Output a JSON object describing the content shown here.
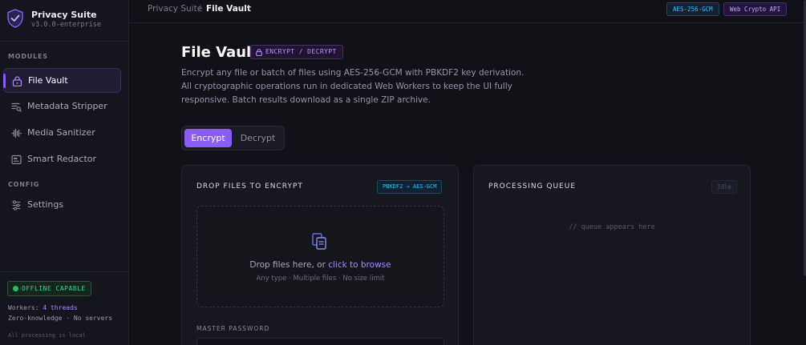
{
  "brand": {
    "name": "Privacy Suite",
    "version": "v3.0.0-enterprise"
  },
  "sidebar": {
    "modules_label": "MODULES",
    "config_label": "CONFIG",
    "items": [
      {
        "label": "File Vault",
        "icon": "lock-icon",
        "active": true
      },
      {
        "label": "Metadata Stripper",
        "icon": "filter-list-icon",
        "active": false
      },
      {
        "label": "Media Sanitizer",
        "icon": "waveform-icon",
        "active": false
      },
      {
        "label": "Smart Redactor",
        "icon": "redact-icon",
        "active": false
      }
    ],
    "config_items": [
      {
        "label": "Settings",
        "icon": "sliders-icon"
      }
    ],
    "footer": {
      "badge": "OFFLINE CAPABLE",
      "workers_prefix": "Workers: ",
      "workers_value": "4 threads",
      "zero_knowledge": "Zero-knowledge · No servers",
      "local_note": "All processing is local"
    }
  },
  "topbar": {
    "breadcrumb_root": "Privacy Suite",
    "breadcrumb_sep": "/",
    "breadcrumb_current": "File Vault",
    "badge_algo": "AES-256-GCM",
    "badge_api": "Web Crypto API"
  },
  "main": {
    "title": "File Vault",
    "mode_badge": "ENCRYPT / DECRYPT",
    "description": "Encrypt any file or batch of files using AES-256-GCM with PBKDF2 key derivation. All cryptographic operations run in dedicated Web Workers to keep the UI fully responsive. Batch results download as a single ZIP archive.",
    "tabs": {
      "encrypt": "Encrypt",
      "decrypt": "Decrypt"
    }
  },
  "dropzone_panel": {
    "title": "DROP FILES TO ENCRYPT",
    "badge": "PBKDF2 → AES-GCM",
    "drop_text": "Drop files here, or ",
    "browse_link": "click to browse",
    "sub_text": "Any type · Multiple files · No size limit",
    "password_label": "MASTER PASSWORD",
    "password_value": ""
  },
  "queue_panel": {
    "title": "PROCESSING QUEUE",
    "status": "Idle",
    "empty_text": "// queue appears here"
  },
  "colors": {
    "accent": "#8b5cf6",
    "background": "#111118",
    "panel": "#17171f",
    "success": "#22c55e",
    "info": "#38bdf8"
  }
}
